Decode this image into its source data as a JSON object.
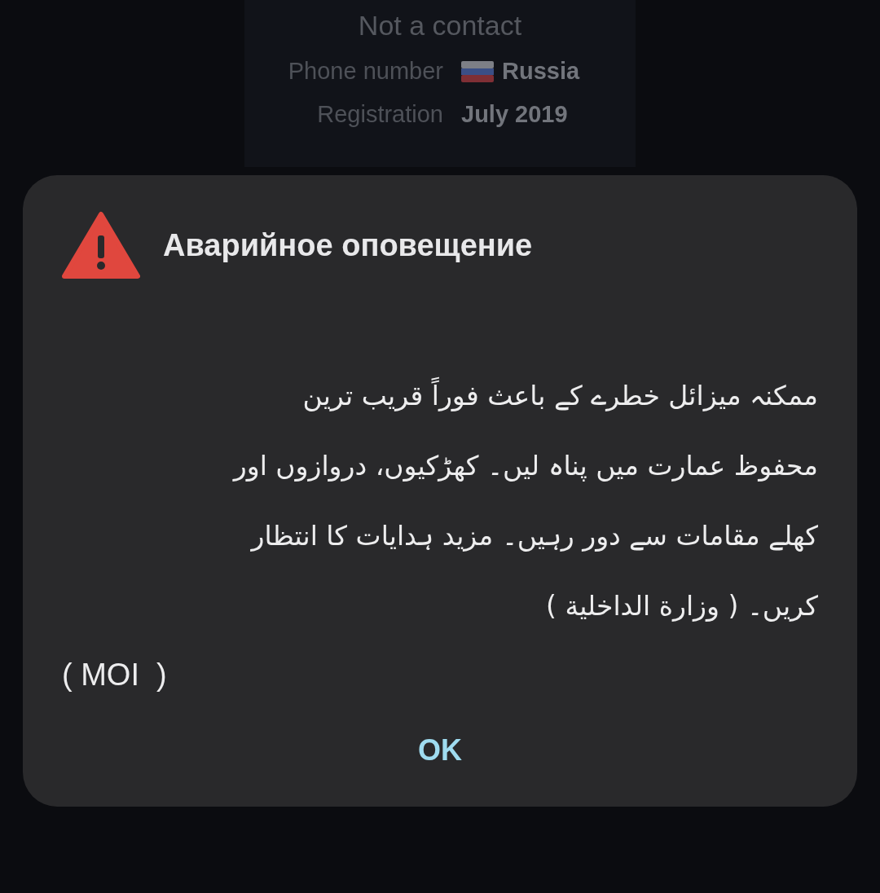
{
  "profile": {
    "status": "Not a contact",
    "rows": [
      {
        "label": "Phone number",
        "value": "Russia",
        "kind": "flag"
      },
      {
        "label": "Registration",
        "value": "July 2019",
        "kind": "plain"
      }
    ]
  },
  "alert": {
    "title": "Аварийное оповещение",
    "message_lines": [
      "ممکنہ میزائل خطرے کے باعث فوراً قریب ترین",
      "محفوظ عمارت میں پناہ لیں۔ کھڑکیوں، دروازوں اور",
      "کھلے مقامات سے دور رہیں۔ مزید ہدایات کا انتظار",
      "کریں۔ ( وزارة الداخلية )"
    ],
    "signature": "( MOI  )",
    "button": "OK"
  }
}
